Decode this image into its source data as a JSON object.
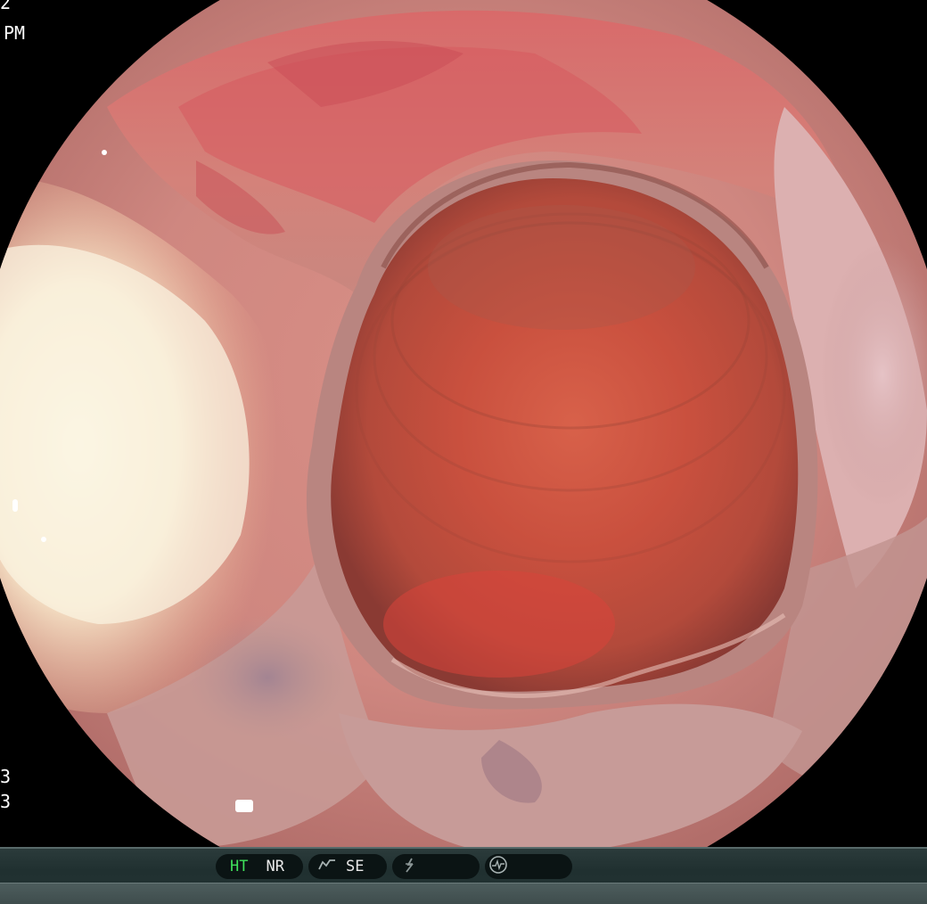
{
  "overlay": {
    "top_left_line1": "2",
    "top_left_line2": "PM",
    "bottom_left_line1": "3",
    "bottom_left_line2": "3"
  },
  "status_bar": {
    "ht_label": "HT",
    "nr_label": "NR",
    "se_label": "SE",
    "enhance_icon": "enhance-curve-icon",
    "flash_icon": "lightning-icon",
    "waveform_icon": "waveform-circle-icon",
    "colors": {
      "bar": "#203030",
      "pill": "#0b1414",
      "active_label": "#3fe05a",
      "label": "#e8e8e8"
    }
  }
}
